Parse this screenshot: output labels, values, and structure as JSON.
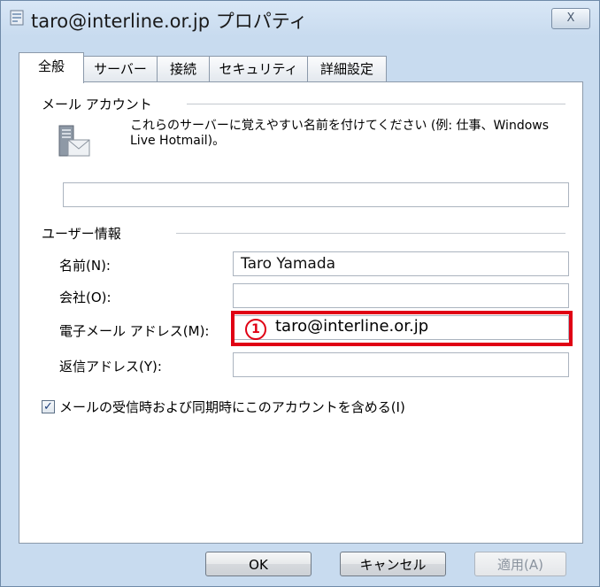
{
  "window": {
    "title": "taro@interline.or.jp プロパティ",
    "close_label": "X"
  },
  "tabs": [
    {
      "label": "全般",
      "active": true
    },
    {
      "label": "サーバー",
      "active": false
    },
    {
      "label": "接続",
      "active": false
    },
    {
      "label": "セキュリティ",
      "active": false
    },
    {
      "label": "詳細設定",
      "active": false
    }
  ],
  "mail_account": {
    "section_label": "メール アカウント",
    "description": "これらのサーバーに覚えやすい名前を付けてください (例: 仕事、Windows Live Hotmail)。",
    "account_name_value": ""
  },
  "user_info": {
    "section_label": "ユーザー情報",
    "name_label": "名前(N):",
    "name_value": "Taro Yamada",
    "company_label": "会社(O):",
    "company_value": "",
    "email_label": "電子メール アドレス(M):",
    "email_value": "taro@interline.or.jp",
    "reply_label": "返信アドレス(Y):",
    "reply_value": ""
  },
  "annotation": {
    "step_number": "1",
    "highlight_color": "#e00014"
  },
  "include_account": {
    "label": "メールの受信時および同期時にこのアカウントを含める(I)",
    "checked": true
  },
  "buttons": {
    "ok": "OK",
    "cancel": "キャンセル",
    "apply": "適用(A)"
  }
}
